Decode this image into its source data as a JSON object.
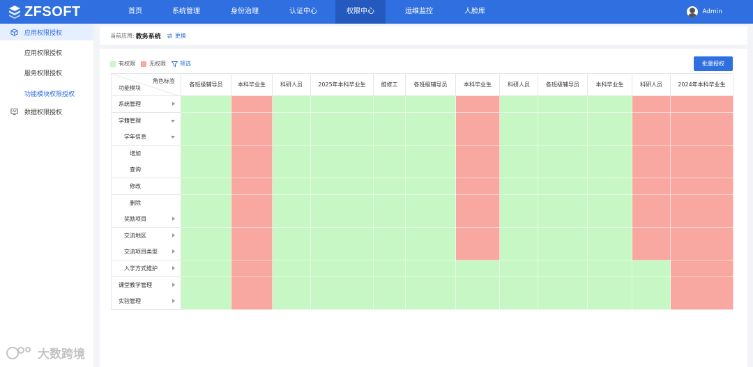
{
  "app": {
    "logo_text": "ZFSOFT",
    "nav": [
      {
        "label": "首页",
        "active": false
      },
      {
        "label": "系统管理",
        "active": false
      },
      {
        "label": "身份治理",
        "active": false
      },
      {
        "label": "认证中心",
        "active": false
      },
      {
        "label": "权限中心",
        "active": true
      },
      {
        "label": "运维监控",
        "active": false
      },
      {
        "label": "人脸库",
        "active": false
      }
    ],
    "user_name": "Admin"
  },
  "sidebar": {
    "group1": {
      "label": "应用权限授权",
      "icon": "cube-icon"
    },
    "subs": [
      "应用权限授权",
      "服务权限授权",
      "功能模块权限授权"
    ],
    "group2": {
      "label": "数据权限授权",
      "icon": "monitor-icon"
    }
  },
  "breadcrumb": {
    "prefix": "当前应用:",
    "app_name": "教务系统",
    "switch_label": "更换"
  },
  "legend": {
    "yes_label": "有权限",
    "no_label": "无权限",
    "filter_label": "筛选",
    "yes_color": "#c6f7c4",
    "no_color": "#f9a7a1"
  },
  "batch_button": "批量授权",
  "matrix": {
    "corner_role": "角色标签",
    "corner_func": "功能模块",
    "columns": [
      "各班级辅导员",
      "本科毕业生",
      "科研人员",
      "2025年本科毕业生",
      "维修工",
      "各班级辅导员",
      "本科毕业生",
      "科研人员",
      "各班级辅导员",
      "本科毕业生",
      "科研人员",
      "2024年本科毕业生"
    ],
    "rows": [
      {
        "label": "系统管理",
        "level": 0,
        "caret": "right"
      },
      {
        "label": "学籍管理",
        "level": 0,
        "caret": "down"
      },
      {
        "label": "学年信息",
        "level": 1,
        "caret": "down"
      },
      {
        "label": "增加",
        "level": 2,
        "caret": ""
      },
      {
        "label": "查询",
        "level": 2,
        "caret": ""
      },
      {
        "label": "修改",
        "level": 2,
        "caret": ""
      },
      {
        "label": "删除",
        "level": 2,
        "caret": ""
      },
      {
        "label": "奖励项目",
        "level": 1,
        "caret": "right"
      },
      {
        "label": "交流地区",
        "level": 1,
        "caret": "right"
      },
      {
        "label": "交流项目类型",
        "level": 1,
        "caret": "right"
      },
      {
        "label": "入学方式维护",
        "level": 1,
        "caret": "right"
      },
      {
        "label": "课堂教学管理",
        "level": 0,
        "caret": "right"
      },
      {
        "label": "实验管理",
        "level": 0,
        "caret": "right"
      }
    ],
    "permissions": [
      [
        1,
        0,
        1,
        1,
        1,
        1,
        0,
        1,
        1,
        1,
        0,
        0
      ],
      [
        1,
        0,
        1,
        1,
        1,
        1,
        0,
        1,
        1,
        1,
        0,
        0
      ],
      [
        1,
        0,
        1,
        1,
        1,
        1,
        0,
        1,
        1,
        1,
        0,
        0
      ],
      [
        1,
        0,
        1,
        1,
        1,
        1,
        0,
        1,
        1,
        1,
        0,
        0
      ],
      [
        1,
        0,
        1,
        1,
        1,
        1,
        0,
        1,
        1,
        1,
        0,
        0
      ],
      [
        1,
        0,
        1,
        1,
        1,
        1,
        0,
        1,
        1,
        1,
        0,
        0
      ],
      [
        1,
        0,
        1,
        1,
        1,
        1,
        0,
        1,
        1,
        1,
        0,
        0
      ],
      [
        1,
        0,
        1,
        1,
        1,
        1,
        0,
        1,
        1,
        1,
        0,
        0
      ],
      [
        1,
        0,
        1,
        1,
        1,
        1,
        0,
        1,
        1,
        1,
        0,
        0
      ],
      [
        1,
        0,
        1,
        1,
        1,
        1,
        0,
        1,
        1,
        1,
        0,
        0
      ],
      [
        1,
        0,
        1,
        1,
        1,
        1,
        1,
        1,
        1,
        1,
        1,
        0
      ],
      [
        1,
        0,
        1,
        1,
        1,
        1,
        1,
        1,
        1,
        1,
        1,
        0
      ],
      [
        1,
        0,
        1,
        1,
        1,
        1,
        1,
        1,
        1,
        1,
        1,
        0
      ]
    ]
  },
  "watermark": "大数跨境"
}
